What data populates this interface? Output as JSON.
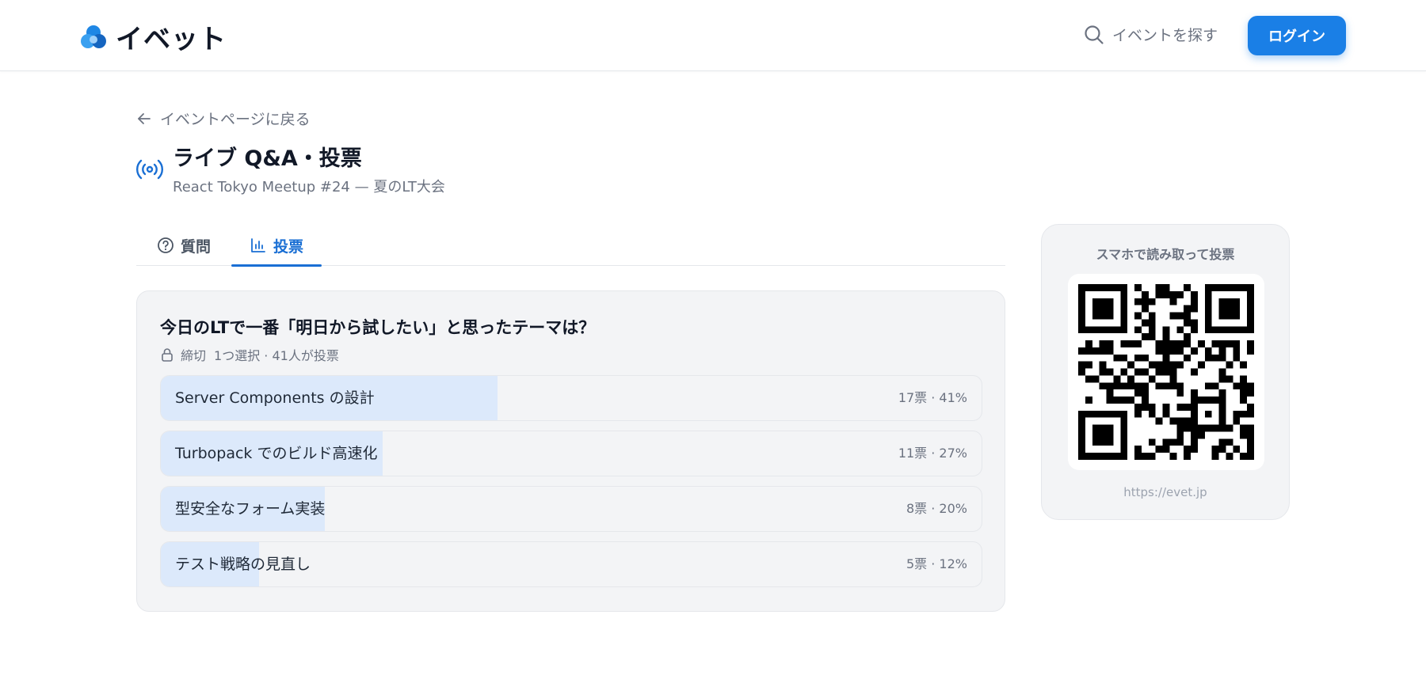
{
  "header": {
    "logo_text": "イベット",
    "search_label": "イベントを探す",
    "login_label": "ログイン",
    "brand_color": "#1a7fe6"
  },
  "back_link": "イベントページに戻る",
  "page": {
    "title": "ライブ Q&A・投票",
    "subtitle": "React Tokyo Meetup #24 — 夏のLT大会"
  },
  "tabs": [
    {
      "label": "質問",
      "icon": "question-circle-icon",
      "active": false
    },
    {
      "label": "投票",
      "icon": "bar-chart-icon",
      "active": true
    }
  ],
  "poll": {
    "question": "今日のLTで一番「明日から試したい」と思ったテーマは？",
    "status": "締切",
    "meta": "1つ選択 · 41人が投票",
    "options": [
      {
        "label": "Server Components の設計",
        "stats": "17票 · 41%",
        "percent": 41
      },
      {
        "label": "Turbopack でのビルド高速化",
        "stats": "11票 · 27%",
        "percent": 27
      },
      {
        "label": "型安全なフォーム実装",
        "stats": "8票 · 20%",
        "percent": 20
      },
      {
        "label": "テスト戦略の見直し",
        "stats": "5票 · 12%",
        "percent": 12
      }
    ]
  },
  "qr": {
    "title": "スマホで読み取って投票",
    "url": "https://evet.jp"
  }
}
